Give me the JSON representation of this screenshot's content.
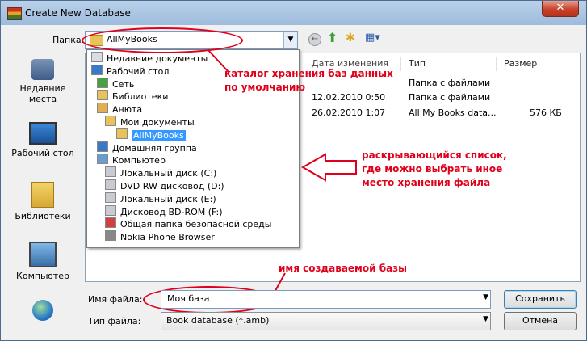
{
  "window": {
    "title": "Create New Database",
    "close": "✕"
  },
  "toolbar": {
    "lookin_label": "Папка:",
    "lookin_value": "AllMyBooks"
  },
  "places": [
    {
      "label": "Недавние места",
      "icon": "recent-places-icon"
    },
    {
      "label": "Рабочий стол",
      "icon": "desktop-icon"
    },
    {
      "label": "Библиотеки",
      "icon": "libraries-icon"
    },
    {
      "label": "Компьютер",
      "icon": "computer-icon"
    },
    {
      "label": "",
      "icon": "network-icon"
    }
  ],
  "filelist": {
    "columns": {
      "date": "Дата изменения",
      "type": "Тип",
      "size": "Размер"
    },
    "rows": [
      {
        "date": "",
        "type": "Папка с файлами",
        "size": ""
      },
      {
        "date": "12.02.2010 0:50",
        "type": "Папка с файлами",
        "size": ""
      },
      {
        "date": "26.02.2010 1:07",
        "type": "All My Books data...",
        "size": "576 КБ"
      }
    ]
  },
  "dropdown": [
    {
      "label": "Недавние документы",
      "indent": 0,
      "icon": "recent-docs-icon",
      "color": "#d9dde4"
    },
    {
      "label": "Рабочий стол",
      "indent": 0,
      "icon": "desktop-icon",
      "color": "#3a78c8"
    },
    {
      "label": "Сеть",
      "indent": 1,
      "icon": "network-icon",
      "color": "#4aa040"
    },
    {
      "label": "Библиотеки",
      "indent": 1,
      "icon": "libraries-icon",
      "color": "#e8c35a"
    },
    {
      "label": "Анюта",
      "indent": 1,
      "icon": "user-folder-icon",
      "color": "#e0b050"
    },
    {
      "label": "Мои документы",
      "indent": 2,
      "icon": "documents-icon",
      "color": "#e8c35a"
    },
    {
      "label": "AllMyBooks",
      "indent": 3,
      "icon": "folder-icon",
      "color": "#e8c35a",
      "selected": true
    },
    {
      "label": "Домашняя группа",
      "indent": 1,
      "icon": "homegroup-icon",
      "color": "#3a78c8"
    },
    {
      "label": "Компьютер",
      "indent": 1,
      "icon": "computer-icon",
      "color": "#6a9ccf"
    },
    {
      "label": "Локальный диск (C:)",
      "indent": 2,
      "icon": "drive-icon",
      "color": "#c8ccd2"
    },
    {
      "label": "DVD RW дисковод (D:)",
      "indent": 2,
      "icon": "dvd-drive-icon",
      "color": "#c8ccd2"
    },
    {
      "label": "Локальный диск (E:)",
      "indent": 2,
      "icon": "drive-icon",
      "color": "#c8ccd2"
    },
    {
      "label": "Дисковод BD-ROM (F:)",
      "indent": 2,
      "icon": "bd-drive-icon",
      "color": "#c8ccd2"
    },
    {
      "label": "Общая папка безопасной среды",
      "indent": 2,
      "icon": "secure-folder-icon",
      "color": "#d04040"
    },
    {
      "label": "Nokia Phone Browser",
      "indent": 2,
      "icon": "phone-icon",
      "color": "#888888"
    }
  ],
  "annotations": {
    "lookin_note_1": "каталог хранения баз данных",
    "lookin_note_2": "по умолчанию",
    "list_note_1": "раскрывающийся список,",
    "list_note_2": "где можно выбрать иное",
    "list_note_3": "место хранения файла",
    "name_note": "имя создаваемой базы",
    "accent_color": "#e0001b"
  },
  "bottom": {
    "filename_label": "Имя файла:",
    "filename_value": "Моя база",
    "filetype_label": "Тип файла:",
    "filetype_value": "Book database (*.amb)",
    "save_label": "Сохранить",
    "cancel_label": "Отмена"
  }
}
